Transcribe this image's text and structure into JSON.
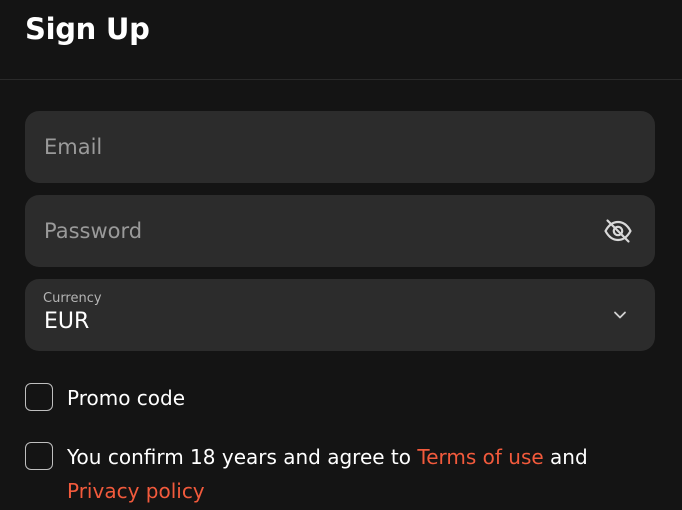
{
  "header": {
    "title": "Sign Up"
  },
  "form": {
    "email": {
      "placeholder": "Email",
      "value": ""
    },
    "password": {
      "placeholder": "Password",
      "value": "",
      "toggle_icon": "eye-off-icon"
    },
    "currency": {
      "caption": "Currency",
      "value": "EUR",
      "dropdown_icon": "chevron-down-icon"
    },
    "promo": {
      "label": "Promo code",
      "checked": false
    },
    "terms": {
      "text_before": "You confirm 18 years and agree to ",
      "terms_link": "Terms of use",
      "text_between": " and",
      "privacy_link": "Privacy policy",
      "checked": false
    }
  },
  "colors": {
    "background": "#141414",
    "field_background": "#2c2c2c",
    "link": "#f25a3c"
  }
}
